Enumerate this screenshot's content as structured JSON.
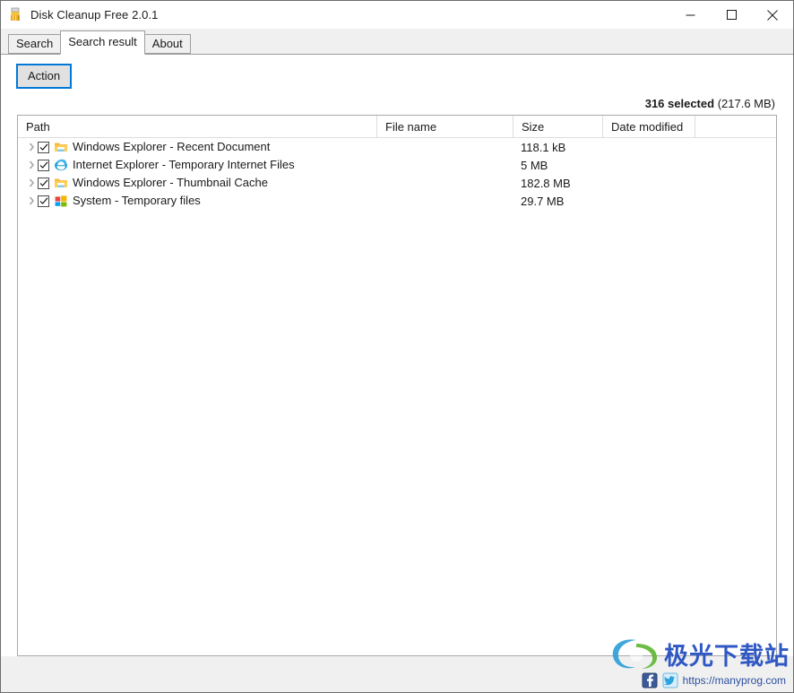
{
  "window": {
    "title": "Disk Cleanup Free 2.0.1",
    "icon": "broom-icon",
    "controls": {
      "minimize": "minimize-icon",
      "maximize": "maximize-icon",
      "close": "close-icon"
    }
  },
  "tabs": [
    {
      "label": "Search",
      "active": false
    },
    {
      "label": "Search result",
      "active": true
    },
    {
      "label": "About",
      "active": false
    }
  ],
  "toolbar": {
    "action_label": "Action",
    "focus_color": "#0078d7"
  },
  "status": {
    "count_text": "316 selected",
    "bytes_text": "(217.6 MB)"
  },
  "list": {
    "columns": [
      {
        "key": "path",
        "label": "Path"
      },
      {
        "key": "name",
        "label": "File name"
      },
      {
        "key": "size",
        "label": "Size"
      },
      {
        "key": "date",
        "label": "Date modified"
      }
    ],
    "rows": [
      {
        "expander": "chevron-right-icon",
        "checked": true,
        "icon": "folder-icon",
        "path": "Windows Explorer - Recent Document",
        "name": "",
        "size": "118.1 kB",
        "date": ""
      },
      {
        "expander": "chevron-right-icon",
        "checked": true,
        "icon": "internet-explorer-icon",
        "path": "Internet Explorer - Temporary Internet Files",
        "name": "",
        "size": "5 MB",
        "date": ""
      },
      {
        "expander": "chevron-right-icon",
        "checked": true,
        "icon": "folder-icon",
        "path": "Windows Explorer - Thumbnail Cache",
        "name": "",
        "size": "182.8 MB",
        "date": ""
      },
      {
        "expander": "chevron-right-icon",
        "checked": true,
        "icon": "windows-logo-icon",
        "path": "System - Temporary files",
        "name": "",
        "size": "29.7 MB",
        "date": ""
      }
    ]
  },
  "footer": {
    "facebook_icon": "facebook-icon",
    "twitter_icon": "twitter-icon",
    "url": "https://manyprog.com",
    "url_color": "#2b4fa0"
  },
  "watermark": {
    "text": "极光下载站",
    "color": "#2f58c4",
    "logo": "swirl-logo-icon"
  }
}
